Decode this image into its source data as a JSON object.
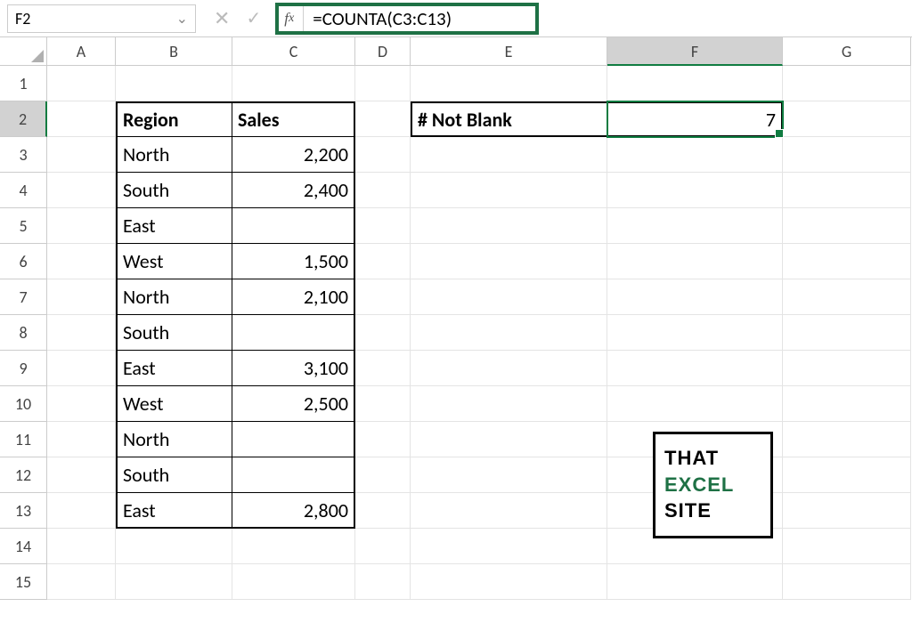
{
  "namebox": "F2",
  "formula": "=COUNTA(C3:C13)",
  "columns": [
    "A",
    "B",
    "C",
    "D",
    "E",
    "F",
    "G"
  ],
  "rows": [
    "1",
    "2",
    "3",
    "4",
    "5",
    "6",
    "7",
    "8",
    "9",
    "10",
    "11",
    "12",
    "13",
    "14",
    "15"
  ],
  "activeCol": "F",
  "activeRow": "2",
  "table": {
    "headers": {
      "region": "Region",
      "sales": "Sales"
    },
    "rows": [
      {
        "region": "North",
        "sales": "2,200"
      },
      {
        "region": "South",
        "sales": "2,400"
      },
      {
        "region": "East",
        "sales": ""
      },
      {
        "region": "West",
        "sales": "1,500"
      },
      {
        "region": "North",
        "sales": "2,100"
      },
      {
        "region": "South",
        "sales": ""
      },
      {
        "region": "East",
        "sales": "3,100"
      },
      {
        "region": "West",
        "sales": "2,500"
      },
      {
        "region": "North",
        "sales": ""
      },
      {
        "region": "South",
        "sales": ""
      },
      {
        "region": "East",
        "sales": "2,800"
      }
    ]
  },
  "summary": {
    "label": "# Not Blank",
    "value": "7"
  },
  "logo": {
    "l1": "THAT",
    "l2": "EXCEL",
    "l3": "SITE"
  }
}
